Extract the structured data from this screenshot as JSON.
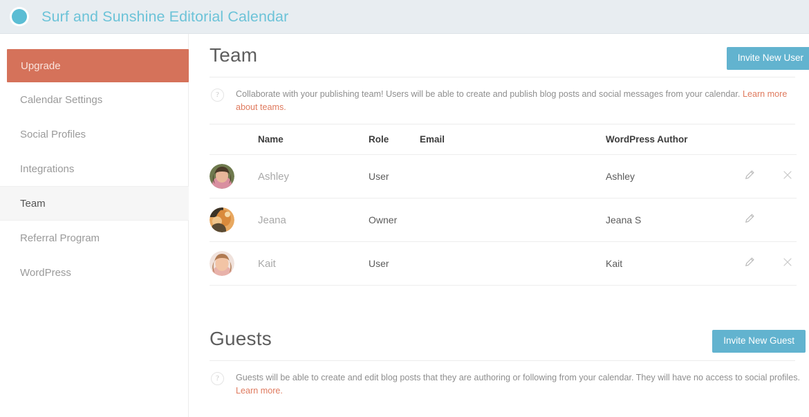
{
  "header": {
    "logo_icon": "circle-logo-icon",
    "title": "Surf and Sunshine Editorial Calendar",
    "bg_color": "#e8edf1",
    "title_color": "#6cc3d8"
  },
  "sidebar": {
    "items": [
      {
        "label": "Upgrade",
        "state": "upgrade",
        "name": "sidebar-item-upgrade"
      },
      {
        "label": "Calendar Settings",
        "state": "default",
        "name": "sidebar-item-calendar-settings"
      },
      {
        "label": "Social Profiles",
        "state": "default",
        "name": "sidebar-item-social-profiles"
      },
      {
        "label": "Integrations",
        "state": "default",
        "name": "sidebar-item-integrations"
      },
      {
        "label": "Team",
        "state": "active",
        "name": "sidebar-item-team"
      },
      {
        "label": "Referral Program",
        "state": "default",
        "name": "sidebar-item-referral-program"
      },
      {
        "label": "WordPress",
        "state": "default",
        "name": "sidebar-item-wordpress"
      }
    ],
    "upgrade_color": "#d5725a",
    "active_bg": "#f6f6f6"
  },
  "team": {
    "title": "Team",
    "invite_button": "Invite New User",
    "help_icon": "question-mark-icon",
    "note_text": "Collaborate with your publishing team! Users will be able to create and publish blog posts and social messages from your calendar. ",
    "note_link": "Learn more about teams.",
    "columns": {
      "name": "Name",
      "role": "Role",
      "email": "Email",
      "wordpress_author": "WordPress Author"
    },
    "rows": [
      {
        "avatar": "avatar-ashley",
        "name": "Ashley",
        "role": "User",
        "email": "",
        "wordpress_author": "Ashley",
        "can_edit": true,
        "can_delete": true
      },
      {
        "avatar": "avatar-jeana",
        "name": "Jeana",
        "role": "Owner",
        "email": "",
        "wordpress_author": "Jeana S",
        "can_edit": true,
        "can_delete": false
      },
      {
        "avatar": "avatar-kait",
        "name": "Kait",
        "role": "User",
        "email": "",
        "wordpress_author": "Kait",
        "can_edit": true,
        "can_delete": true
      }
    ]
  },
  "guests": {
    "title": "Guests",
    "invite_button": "Invite New Guest",
    "help_icon": "question-mark-icon",
    "note_text": "Guests will be able to create and edit blog posts that they are authoring or following from your calendar. They will have no access to social profiles. ",
    "note_link": "Learn more."
  },
  "colors": {
    "primary_button": "#62b3cf",
    "link": "#df7a5e",
    "upgrade": "#d5725a",
    "header_text": "#6cc3d8"
  }
}
